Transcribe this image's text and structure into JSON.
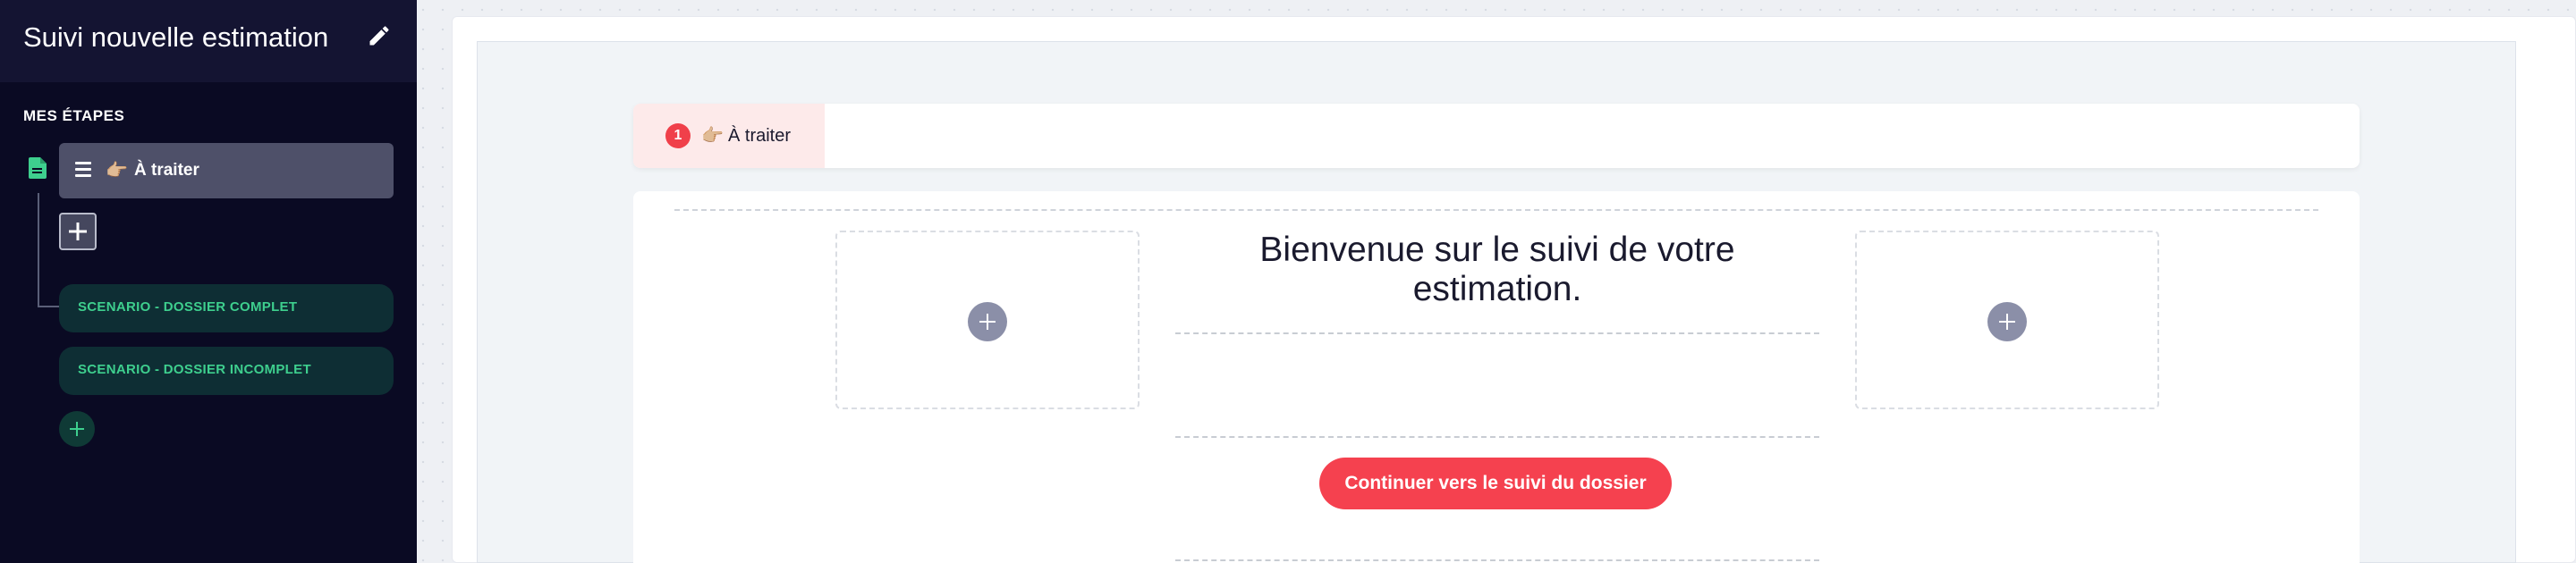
{
  "sidebar": {
    "title": "Suivi nouvelle estimation",
    "section_label": "MES ÉTAPES",
    "steps": [
      {
        "emoji": "👉🏼",
        "label": "À traiter"
      }
    ],
    "scenarios": [
      {
        "label": "SCENARIO - DOSSIER COMPLET"
      },
      {
        "label": "SCENARIO - DOSSIER INCOMPLET"
      }
    ]
  },
  "main": {
    "tabs": [
      {
        "number": "1",
        "emoji": "👉🏼",
        "label": "À traiter"
      }
    ],
    "welcome_text": "Bienvenue sur le suivi de votre estimation.",
    "cta_label": "Continuer vers le suivi du dossier"
  },
  "colors": {
    "sidebar_bg": "#0a0a23",
    "accent": "#f5414f",
    "scenario_text": "#3ecf8e"
  },
  "icons": [
    "pencil-icon",
    "document-icon",
    "hamburger-icon",
    "plus-icon"
  ]
}
